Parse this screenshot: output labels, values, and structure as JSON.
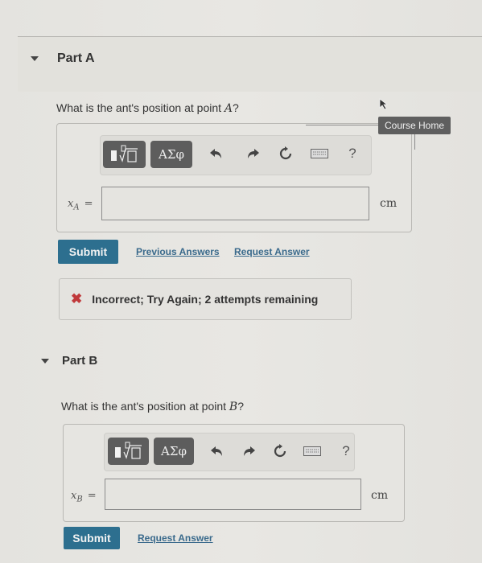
{
  "tooltip": {
    "label": "Course Home"
  },
  "parts": [
    {
      "title": "Part A",
      "question_prefix": "What is the ant's position at point ",
      "question_var": "A",
      "question_suffix": "?",
      "variable": "x",
      "variable_sub": "A",
      "equals": "=",
      "input_value": "",
      "unit": "cm",
      "toolbar": {
        "templates_icon": "fraction-root-template-icon",
        "greek_label": "ΑΣφ",
        "undo_icon": "undo-icon",
        "redo_icon": "redo-icon",
        "reset_icon": "reset-icon",
        "keyboard_icon": "keyboard-icon",
        "help_label": "?"
      },
      "submit_label": "Submit",
      "links": [
        "Previous Answers",
        "Request Answer"
      ],
      "feedback": {
        "icon": "x-icon",
        "message": "Incorrect; Try Again; 2 attempts remaining",
        "color": "#c0393b"
      }
    },
    {
      "title": "Part B",
      "question_prefix": "What is the ant's position at point ",
      "question_var": "B",
      "question_suffix": "?",
      "variable": "x",
      "variable_sub": "B",
      "equals": "=",
      "input_value": "",
      "unit": "cm",
      "toolbar": {
        "templates_icon": "fraction-root-template-icon",
        "greek_label": "ΑΣφ",
        "undo_icon": "undo-icon",
        "redo_icon": "redo-icon",
        "reset_icon": "reset-icon",
        "keyboard_icon": "keyboard-icon",
        "help_label": "?"
      },
      "submit_label": "Submit",
      "links": [
        "Request Answer"
      ]
    }
  ],
  "colors": {
    "submit": "#2d6f8f",
    "link": "#3a6a8c",
    "toolbar_button": "#5d5d5d",
    "error": "#c0393b"
  }
}
